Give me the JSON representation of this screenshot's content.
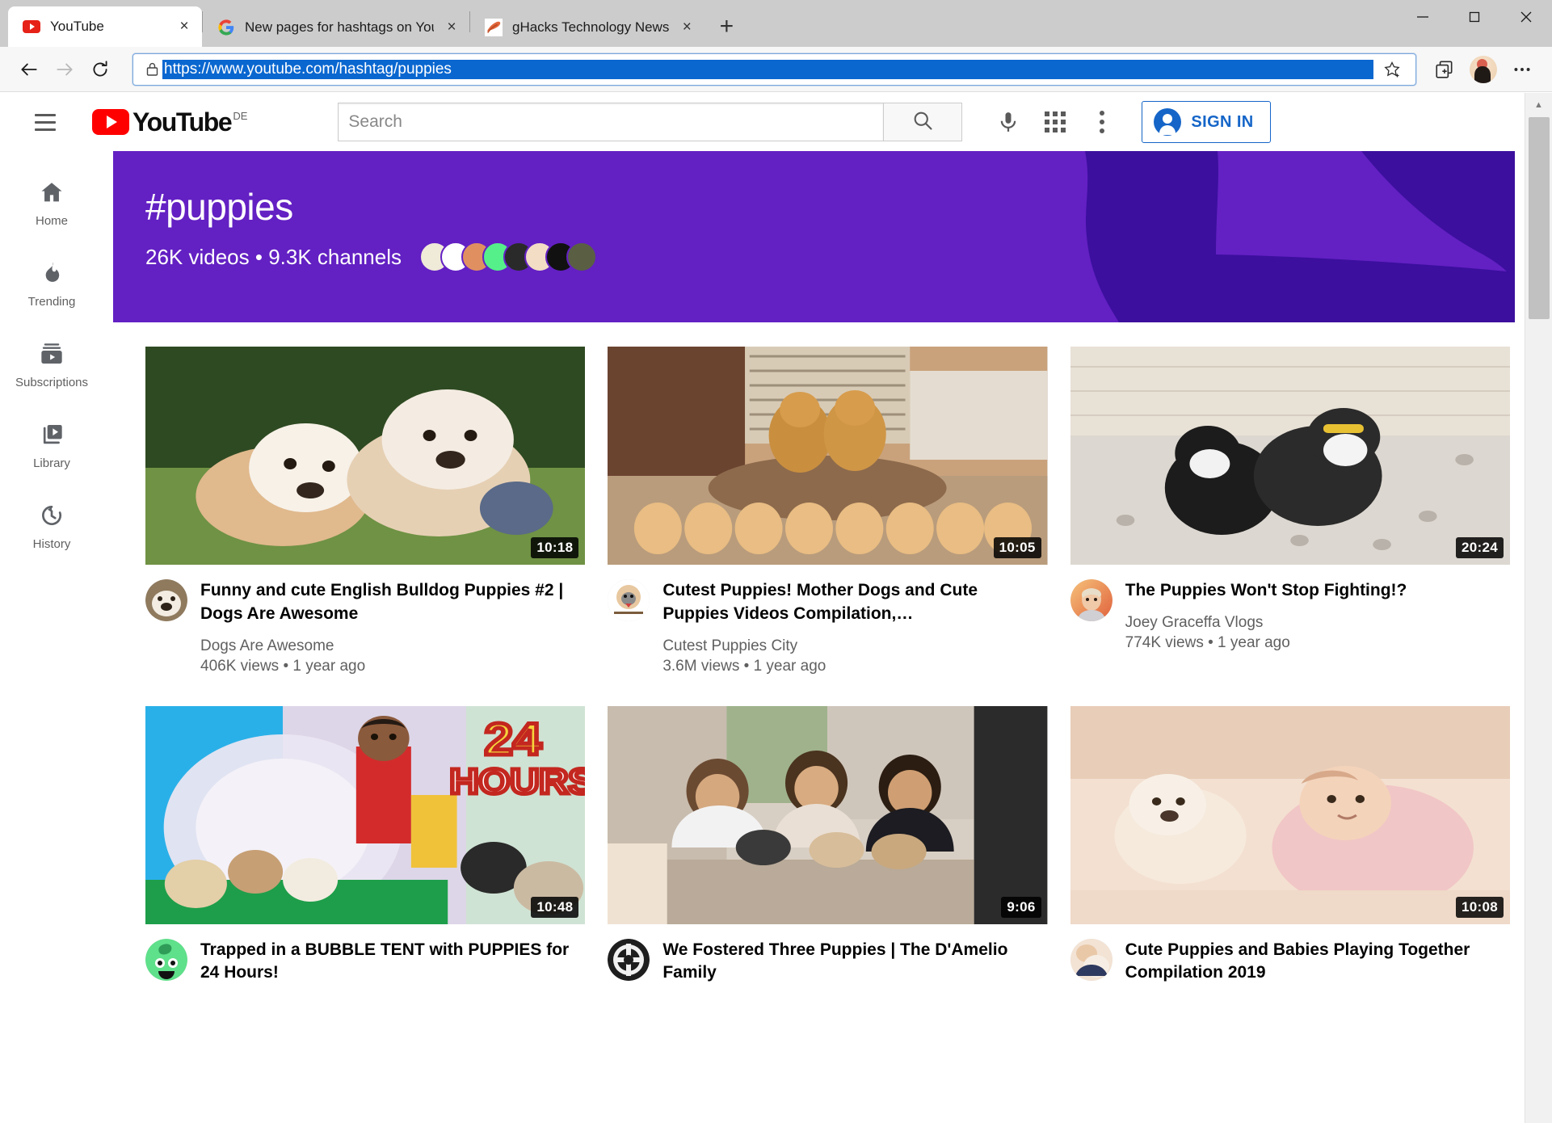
{
  "browser": {
    "tabs": [
      {
        "title": "YouTube",
        "favicon": "youtube-icon",
        "active": true,
        "close_label": "×"
      },
      {
        "title": "New pages for hashtags on YouT",
        "favicon": "google-icon",
        "active": false,
        "close_label": "×"
      },
      {
        "title": "gHacks Technology News",
        "favicon": "ghacks-icon",
        "active": false,
        "close_label": "×"
      }
    ],
    "new_tab_label": "+",
    "window_controls": {
      "minimize": "—",
      "maximize": "□",
      "close": "✕"
    },
    "nav": {
      "back": "←",
      "forward": "→",
      "reload": "↻"
    },
    "address": {
      "url": "https://www.youtube.com/hashtag/puppies",
      "lock_icon": "lock-icon",
      "favorite_icon": "star-add-icon"
    },
    "toolbar_icons": {
      "collections": "collections-icon",
      "profile": "profile-avatar-icon",
      "settings": "more-horizontal-icon"
    }
  },
  "youtube": {
    "menu_icon": "hamburger-menu-icon",
    "logo": {
      "word": "YouTube",
      "country": "DE"
    },
    "search": {
      "placeholder": "Search",
      "button_icon": "search-icon"
    },
    "voice_icon": "microphone-icon",
    "apps_icon": "apps-grid-icon",
    "more_icon": "more-vertical-icon",
    "signin": {
      "label": "SIGN IN",
      "icon": "account-circle-icon"
    },
    "sidebar": [
      {
        "label": "Home",
        "icon": "home-icon"
      },
      {
        "label": "Trending",
        "icon": "trending-flame-icon"
      },
      {
        "label": "Subscriptions",
        "icon": "subscriptions-icon"
      },
      {
        "label": "Library",
        "icon": "library-icon"
      },
      {
        "label": "History",
        "icon": "history-clock-icon"
      }
    ],
    "banner": {
      "title": "#puppies",
      "stats": "26K videos • 9.3K channels",
      "background_color": "#6320c3",
      "art_color": "#3c0f9e",
      "avatar_count": 8
    },
    "videos": [
      {
        "title": "Funny and cute English Bulldog Puppies #2 | Dogs Are Awesome",
        "channel": "Dogs Are Awesome",
        "stats": "406K views • 1 year ago",
        "duration": "10:18"
      },
      {
        "title": "Cutest Puppies! Mother Dogs and Cute Puppies Videos Compilation,…",
        "channel": "Cutest Puppies City",
        "stats": "3.6M views • 1 year ago",
        "duration": "10:05"
      },
      {
        "title": "The Puppies Won't Stop Fighting!?",
        "channel": "Joey Graceffa Vlogs",
        "stats": "774K views • 1 year ago",
        "duration": "20:24"
      },
      {
        "title": "Trapped in a BUBBLE TENT with PUPPIES for 24 Hours!",
        "channel": "",
        "stats": "",
        "duration": "10:48"
      },
      {
        "title": "We Fostered Three Puppies | The D'Amelio Family",
        "channel": "",
        "stats": "",
        "duration": "9:06"
      },
      {
        "title": "Cute Puppies and Babies Playing Together Compilation 2019",
        "channel": "",
        "stats": "",
        "duration": "10:08"
      }
    ],
    "scrollbar": {
      "up_arrow": "▲"
    }
  }
}
